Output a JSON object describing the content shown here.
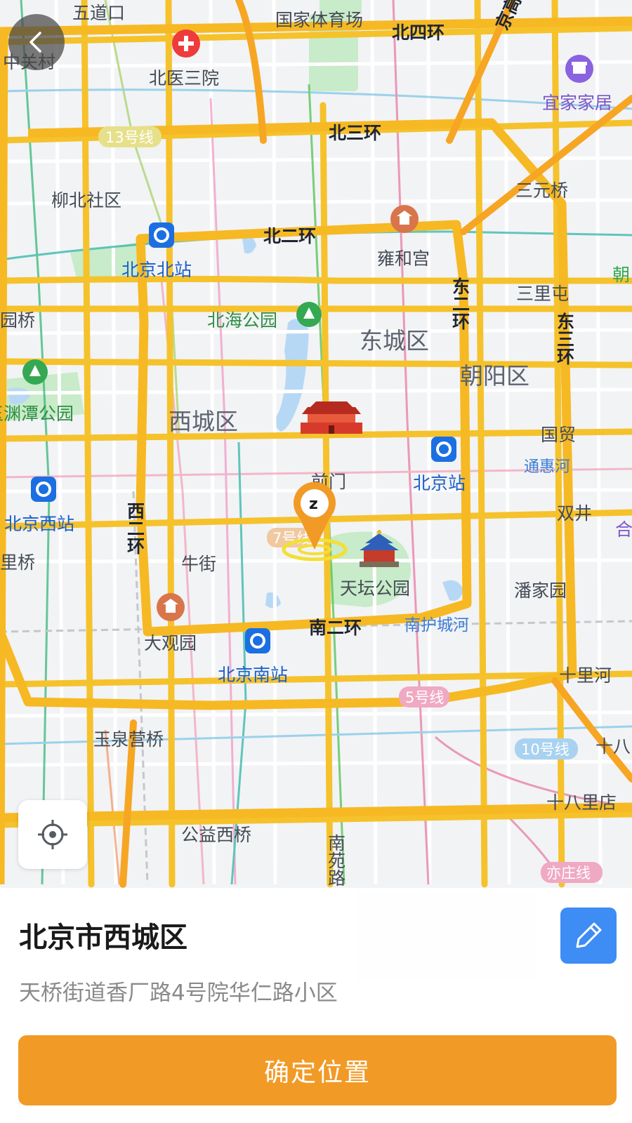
{
  "map": {
    "labels": {
      "wudaokou": "五道口",
      "guojiatiyuchang": "国家体育场",
      "beisihuan": "北四环",
      "jinggaosu": "京高速",
      "zhongguancun": "中关村",
      "beiyisanyuan": "北医三院",
      "yijiajiaju": "宜家家居",
      "line13": "13号线",
      "beisanhuan": "北三环",
      "liubeishequ": "柳北社区",
      "sanyuanqiao": "三元桥",
      "beierhuan": "北二环",
      "yonghegong": "雍和宫",
      "beijingbeizhan": "北京北站",
      "dongerhuan": "东二环",
      "sanlitun": "三里屯",
      "chaoyang_partial": "朝",
      "guoqiao_partial": "园桥",
      "beihaigongyuan": "北海公园",
      "dongchengqu": "东城区",
      "dongsanhuan": "东三环",
      "chaoyangqu": "朝阳区",
      "yuyuantan_partial": "玉渊潭公园",
      "xichengqu": "西城区",
      "guomao": "国贸",
      "tonghuihe": "通惠河",
      "qianmen": "前门",
      "beijingzhan": "北京站",
      "beijingxizhan": "北京西站",
      "xierhuan": "西二环",
      "shuangjing": "双井",
      "he_partial": "合",
      "line7": "7号线",
      "liqiao_partial": "里桥",
      "niujie": "牛街",
      "tiantangongyuan": "天坛公园",
      "panjiayuan": "潘家园",
      "nanerhuan": "南二环",
      "nanhuchenghe": "南护城河",
      "daguanyuan": "大观园",
      "beijingnanzhan": "北京南站",
      "shilihe": "十里河",
      "line5": "5号线",
      "yuquanyingqiao": "玉泉营桥",
      "line10": "10号线",
      "shiba_partial": "十八",
      "shibalidian": "十八里店",
      "gongyixiqiao": "公益西桥",
      "nanyuanlu": "南苑路",
      "yizhuangxian": "亦庄线"
    }
  },
  "address": {
    "title": "北京市西城区",
    "detail": "天桥街道香厂路4号院华仁路小区"
  },
  "confirm": {
    "label": "确定位置"
  },
  "icons": {
    "back": "chevron-left-icon",
    "locate": "crosshair-icon",
    "edit": "edit-pencil-icon",
    "pin": "location-pin-icon"
  },
  "colors": {
    "accent": "#f29a26",
    "edit_blue": "#3d8df5",
    "ring_road": "#f5c22c",
    "highway_orange": "#f6a623"
  }
}
